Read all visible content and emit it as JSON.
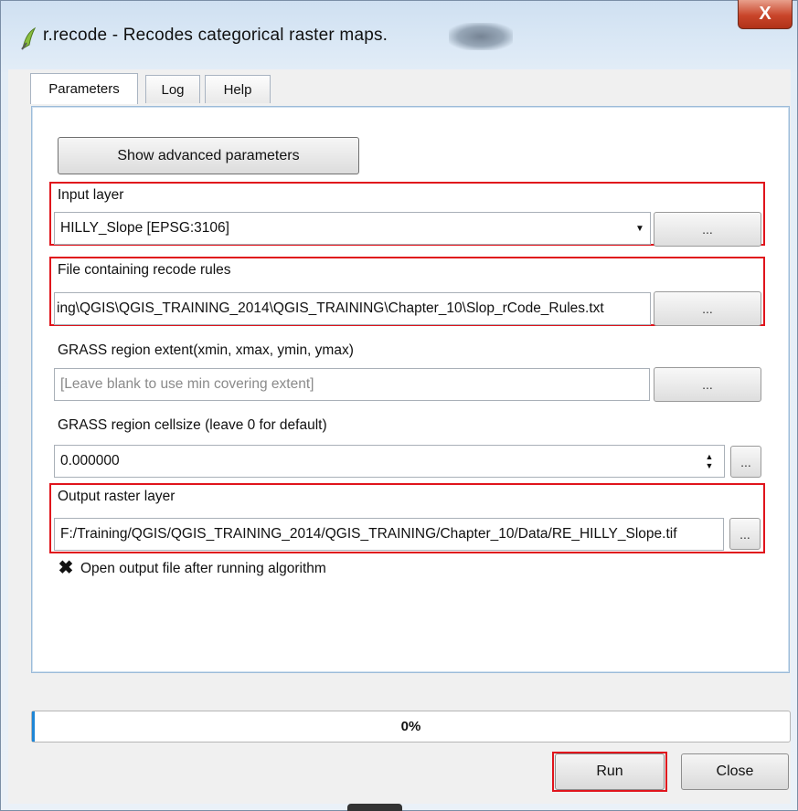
{
  "window": {
    "title": "r.recode - Recodes categorical raster maps.",
    "close_label": "X"
  },
  "tabs": [
    {
      "label": "Parameters",
      "active": true
    },
    {
      "label": "Log"
    },
    {
      "label": "Help"
    }
  ],
  "advanced_button": "Show advanced parameters",
  "fields": {
    "input_layer": {
      "label": "Input layer",
      "value": "HILLY_Slope [EPSG:3106]"
    },
    "recode_rules": {
      "label": "File containing recode rules",
      "value": "ing\\QGIS\\QGIS_TRAINING_2014\\QGIS_TRAINING\\Chapter_10\\Slop_rCode_Rules.txt"
    },
    "region_extent": {
      "label": "GRASS region extent(xmin, xmax, ymin, ymax)",
      "placeholder": "[Leave blank to use min covering extent]"
    },
    "cellsize": {
      "label": "GRASS region cellsize (leave 0 for default)",
      "value": "0.000000"
    },
    "output_raster": {
      "label": "Output raster layer",
      "value": "F:/Training/QGIS/QGIS_TRAINING_2014/QGIS_TRAINING/Chapter_10/Data/RE_HILLY_Slope.tif"
    }
  },
  "browse_label": "...",
  "open_output_checkbox": {
    "label": "Open output file after running algorithm",
    "checked": true,
    "mark": "✖"
  },
  "progress": {
    "value": 0,
    "label": "0%"
  },
  "buttons": {
    "run": "Run",
    "close": "Close"
  },
  "colors": {
    "highlight": "#e0141c",
    "progress": "#1f86d6",
    "panel_border": "#9cbbd9"
  }
}
